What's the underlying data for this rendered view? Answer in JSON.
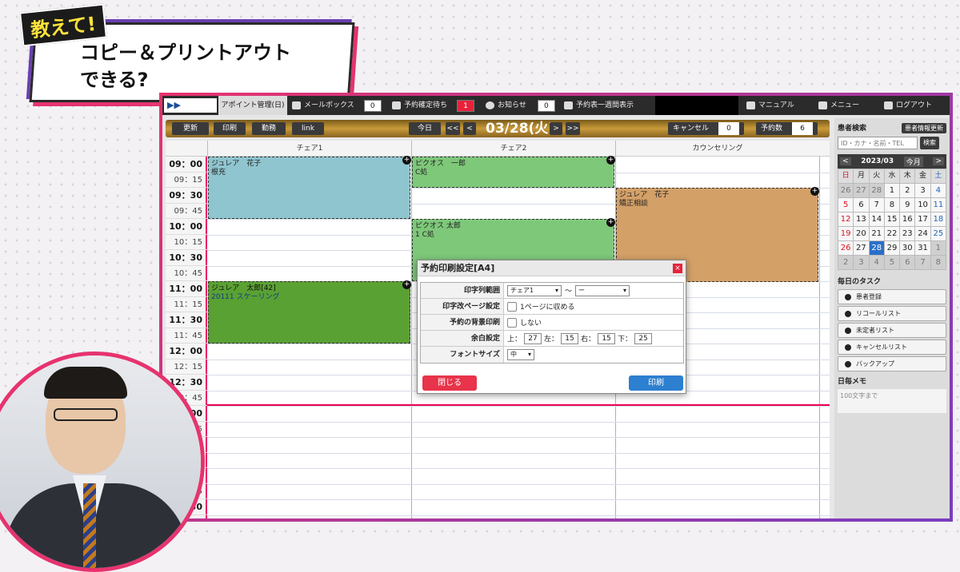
{
  "overlay": {
    "tag": "教えて!",
    "line1": "コピー＆プリントアウト",
    "line2": "できる?"
  },
  "topbar": {
    "logo": "▶▶",
    "tab_appt": "アポイント管理(日)",
    "mailbox": {
      "label": "メールボックス",
      "count": "0"
    },
    "pending": {
      "label": "予約確定待ち",
      "count": "1"
    },
    "notice": {
      "label": "お知らせ",
      "count": "0"
    },
    "weekly": "予約表一週間表示",
    "manual": "マニュアル",
    "menu": "メニュー",
    "logout": "ログアウト"
  },
  "toolbar": {
    "update": "更新",
    "print": "印刷",
    "attendance": "勤務",
    "link": "link",
    "today": "今日",
    "prev_week": "<<",
    "prev": "<",
    "date": "03/28(火)",
    "next": ">",
    "next_week": ">>",
    "cancel_label": "キャンセル",
    "cancel_count": "0",
    "booking_label": "予約数",
    "booking_count": "6"
  },
  "columns": [
    "チェア1",
    "チェア2",
    "カウンセリング"
  ],
  "times": [
    "09：00",
    "09：15",
    "09：30",
    "09：45",
    "10：00",
    "10：15",
    "10：30",
    "10：45",
    "11：00",
    "11：15",
    "11：30",
    "11：45",
    "12：00",
    "12：15",
    "12：30",
    "12：45",
    "13：00",
    "13：15",
    "13：30",
    "13：45",
    "14：00",
    "14：15",
    "14：30"
  ],
  "appointments": [
    {
      "name": "ジュレア　花子",
      "detail": "根充",
      "color": "#8fc5cf"
    },
    {
      "name": "ピクオス　一郎",
      "detail": "C処",
      "color": "#7ec87a"
    },
    {
      "name": "ジュレア　花子",
      "detail": "矯正相談",
      "color": "#d3a068"
    },
    {
      "name": "ピクオス 太郎",
      "detail": "1 C処",
      "color": "#7ec87a"
    },
    {
      "name": "ジュレア　太郎[42]",
      "detail": "20111 スケーリング",
      "color": "#5aa133"
    }
  ],
  "sidebar": {
    "patient_search": "患者検索",
    "update_info": "患者情報更新",
    "search_placeholder": "ID・カナ・名前・TEL",
    "search_btn": "検索",
    "cal_prev": "<",
    "cal_month": "2023/03",
    "cal_this": "今月",
    "cal_next": ">",
    "weekdays": [
      "日",
      "月",
      "火",
      "水",
      "木",
      "金",
      "土"
    ],
    "days": [
      "26",
      "27",
      "28",
      "1",
      "2",
      "3",
      "4",
      "5",
      "6",
      "7",
      "8",
      "9",
      "10",
      "11",
      "12",
      "13",
      "14",
      "15",
      "16",
      "17",
      "18",
      "19",
      "20",
      "21",
      "22",
      "23",
      "24",
      "25",
      "26",
      "27",
      "28",
      "29",
      "30",
      "31",
      "1",
      "2",
      "3",
      "4",
      "5",
      "6",
      "7",
      "8"
    ],
    "tasks_title": "毎日のタスク",
    "tasks": [
      "患者登録",
      "リコールリスト",
      "未定者リスト",
      "キャンセルリスト",
      "バックアップ"
    ],
    "memo_title": "日毎メモ",
    "memo_placeholder": "100文字まで"
  },
  "dialog": {
    "title": "予約印刷設定[A4]",
    "close_x": "×",
    "range_label": "印字列範囲",
    "range_from": "チェア1",
    "range_sep": "〜",
    "range_to": "ー",
    "pagebreak_label": "印字改ページ設定",
    "pagebreak_value": "1ページに収める",
    "bg_label": "予約の背景印刷",
    "bg_value": "しない",
    "margin_label": "余白設定",
    "margin_top_label": "上：",
    "margin_top": "27",
    "margin_left_label": "左：",
    "margin_left": "15",
    "margin_right_label": "右：",
    "margin_right": "15",
    "margin_bottom_label": "下：",
    "margin_bottom": "25",
    "font_label": "フォントサイズ",
    "font_value": "中",
    "close_btn": "閉じる",
    "print_btn": "印刷"
  }
}
